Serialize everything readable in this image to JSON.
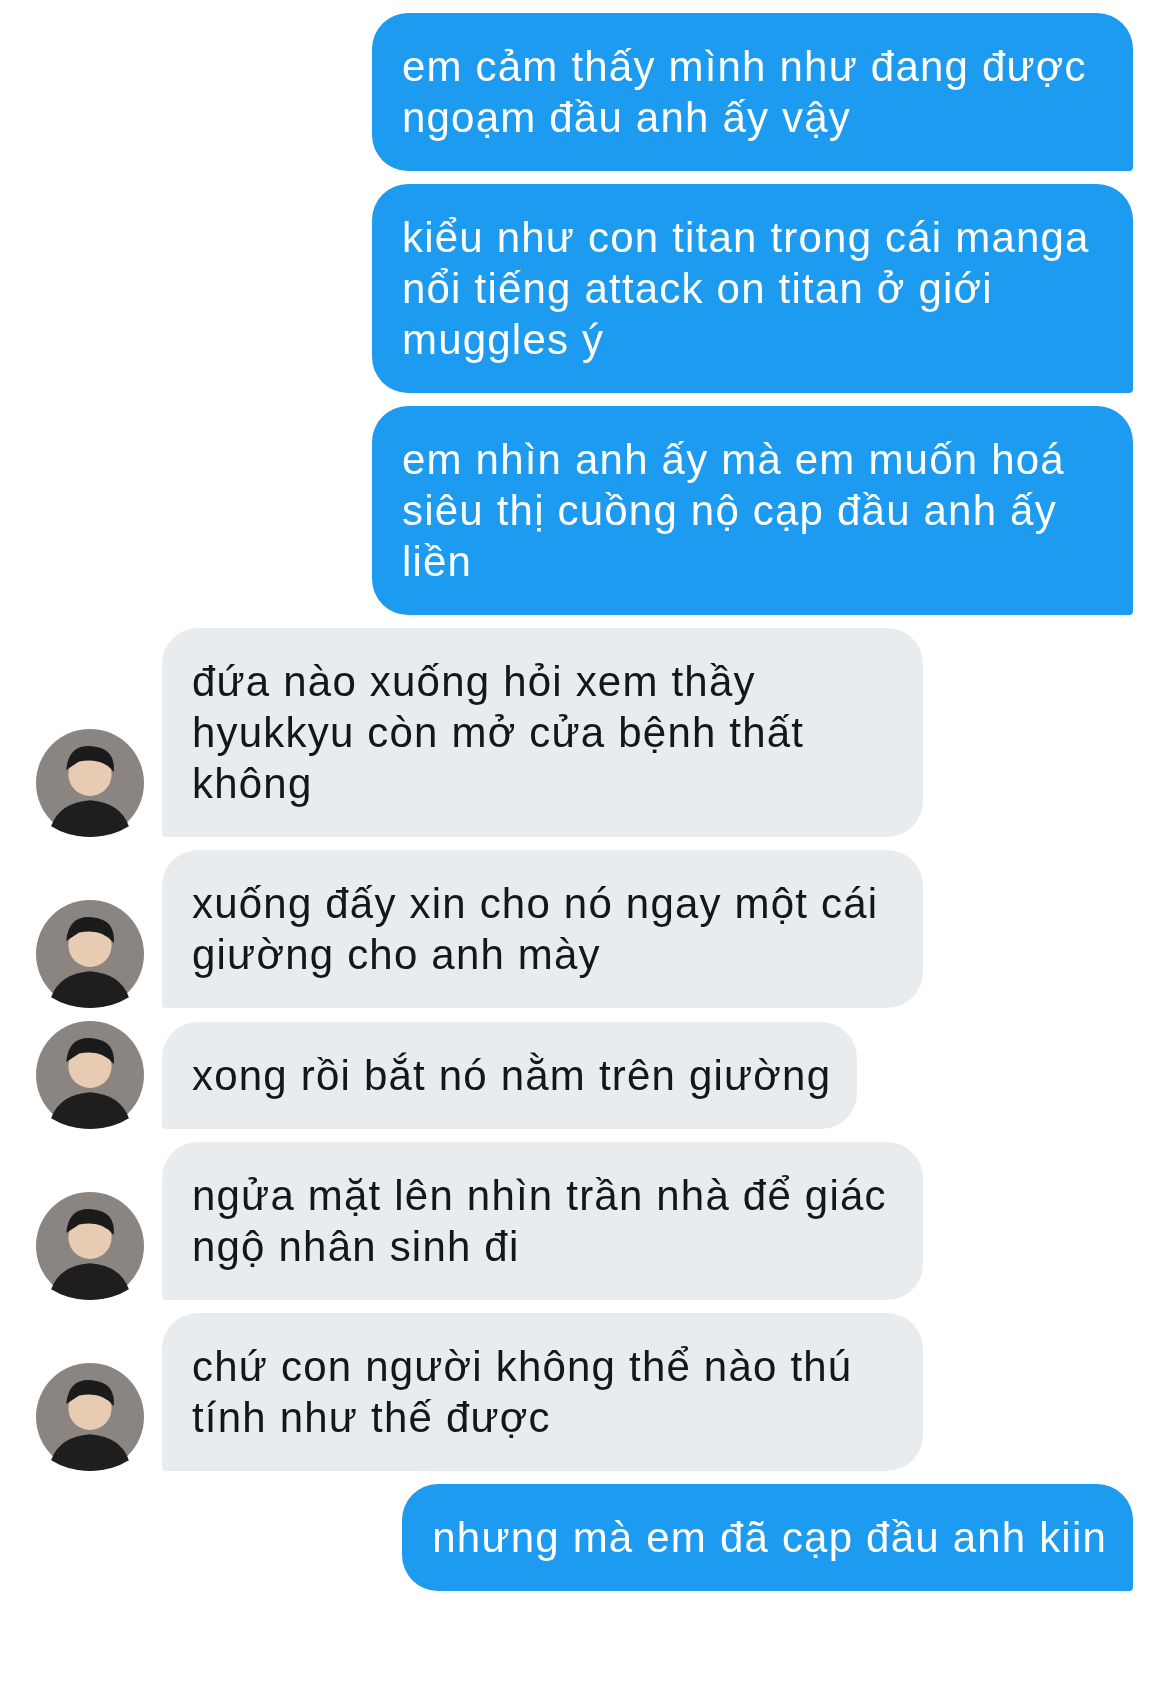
{
  "messages": [
    {
      "kind": "outgoing",
      "text": "em cảm thấy mình như đang được ngoạm đầu anh ấy vậy"
    },
    {
      "kind": "outgoing",
      "text": "kiểu như con titan trong cái manga nổi tiếng attack on titan ở giới muggles ý"
    },
    {
      "kind": "outgoing",
      "text": "em nhìn anh ấy mà em muốn hoá siêu thị cuồng nộ cạp đầu anh ấy liền"
    },
    {
      "kind": "incoming",
      "text": "đứa nào xuống hỏi xem thầy hyukkyu còn mở cửa bệnh thất không"
    },
    {
      "kind": "incoming",
      "text": "xuống đấy xin cho nó ngay một cái giường cho anh mày"
    },
    {
      "kind": "incoming",
      "text": "xong rồi bắt nó nằm trên giường"
    },
    {
      "kind": "incoming",
      "text": "ngửa mặt lên nhìn trần nhà để giác ngộ nhân sinh đi"
    },
    {
      "kind": "incoming",
      "text": "chứ con người không thể nào thú tính như thế được"
    },
    {
      "kind": "outgoing",
      "text": "nhưng mà em đã cạp đầu anh kiin"
    }
  ]
}
